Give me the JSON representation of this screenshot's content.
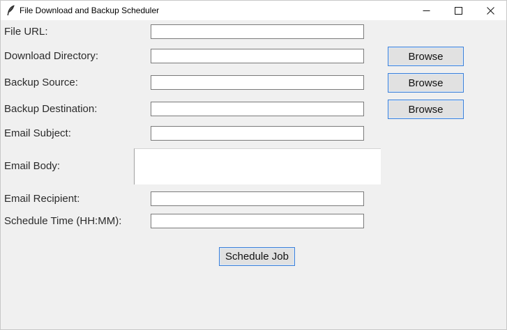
{
  "window": {
    "title": "File Download and Backup Scheduler"
  },
  "form": {
    "file_url": {
      "label": "File URL:",
      "value": ""
    },
    "download_directory": {
      "label": "Download Directory:",
      "value": ""
    },
    "backup_source": {
      "label": "Backup Source:",
      "value": ""
    },
    "backup_destination": {
      "label": "Backup Destination:",
      "value": ""
    },
    "email_subject": {
      "label": "Email Subject:",
      "value": ""
    },
    "email_body": {
      "label": "Email Body:",
      "value": ""
    },
    "email_recipient": {
      "label": "Email Recipient:",
      "value": ""
    },
    "schedule_time": {
      "label": "Schedule Time (HH:MM):",
      "value": ""
    }
  },
  "buttons": {
    "browse_download": "Browse",
    "browse_backup_source": "Browse",
    "browse_backup_destination": "Browse",
    "schedule_job": "Schedule Job"
  },
  "icons": {
    "app": "feather-icon",
    "minimize": "minimize-icon",
    "maximize": "maximize-icon",
    "close": "close-icon"
  },
  "colors": {
    "window_bg": "#f0f0f0",
    "button_bg": "#e1e1e1",
    "focus_border": "#3c7fd6"
  }
}
